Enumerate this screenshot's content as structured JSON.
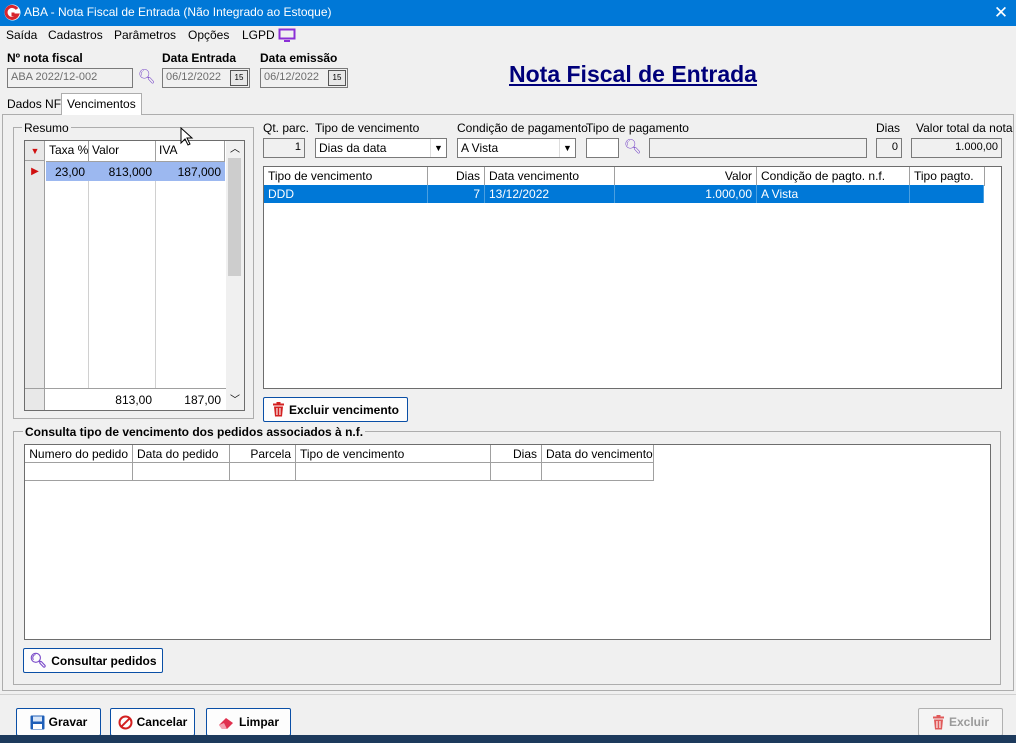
{
  "window": {
    "title": "ABA - Nota Fiscal de Entrada (Não Integrado ao Estoque)",
    "close_glyph": "✕"
  },
  "menu": [
    {
      "label": "Saída"
    },
    {
      "label": "Cadastros"
    },
    {
      "label": "Parâmetros"
    },
    {
      "label": "Opções"
    },
    {
      "label": "LGPD"
    }
  ],
  "header": {
    "nota_fiscal_label": "Nº nota fiscal",
    "nota_fiscal_value": "ABA 2022/12-002",
    "data_entrada_label": "Data Entrada",
    "data_entrada_value": "06/12/2022",
    "data_emissao_label": "Data emissão",
    "data_emissao_value": "06/12/2022",
    "calendar_badge": "15",
    "page_title": "Nota Fiscal de Entrada"
  },
  "tabs": [
    {
      "label": "Dados NF",
      "active": false
    },
    {
      "label": "Vencimentos",
      "active": true
    }
  ],
  "resumo": {
    "title": "Resumo",
    "columns": [
      "Taxa %",
      "Valor",
      "IVA"
    ],
    "rows": [
      {
        "taxa": "23,00",
        "valor": "813,000",
        "iva": "187,000"
      }
    ],
    "totals": {
      "valor": "813,00",
      "iva": "187,00"
    }
  },
  "vencimento_form": {
    "qt_parc_label": "Qt. parc.",
    "qt_parc_value": "1",
    "tipo_venc_label": "Tipo de vencimento",
    "tipo_venc_value": "Dias da data",
    "cond_pag_label": "Condição de pagamento",
    "cond_pag_value": "A Vista",
    "tipo_pag_label": "Tipo de pagamento",
    "tipo_pag_value": "",
    "tipo_pag_desc": "",
    "dias_label": "Dias",
    "dias_value": "0",
    "valor_total_label": "Valor total da nota",
    "valor_total_value": "1.000,00"
  },
  "vencimentos_grid": {
    "columns": [
      "Tipo de vencimento",
      "Dias",
      "Data vencimento",
      "Valor",
      "Condição de pagto. n.f.",
      "Tipo pagto."
    ],
    "rows": [
      {
        "tipo": "DDD",
        "dias": "7",
        "data": "13/12/2022",
        "valor": "1.000,00",
        "condicao": "A Vista",
        "tipo_pagto": ""
      }
    ]
  },
  "excluir_vencimento_label": "Excluir vencimento",
  "consulta": {
    "title": "Consulta tipo de vencimento dos pedidos associados à n.f.",
    "columns": [
      "Numero do pedido",
      "Data do pedido",
      "Parcela",
      "Tipo de vencimento",
      "Dias",
      "Data do vencimento"
    ],
    "consultar_label": "Consultar pedidos"
  },
  "footer": {
    "gravar": "Gravar",
    "cancelar": "Cancelar",
    "limpar": "Limpar",
    "excluir": "Excluir"
  },
  "colors": {
    "titlebar": "#0078d7",
    "selection": "#0078d7",
    "heading": "#00007a",
    "grid_selected": "#9cb8f0"
  }
}
